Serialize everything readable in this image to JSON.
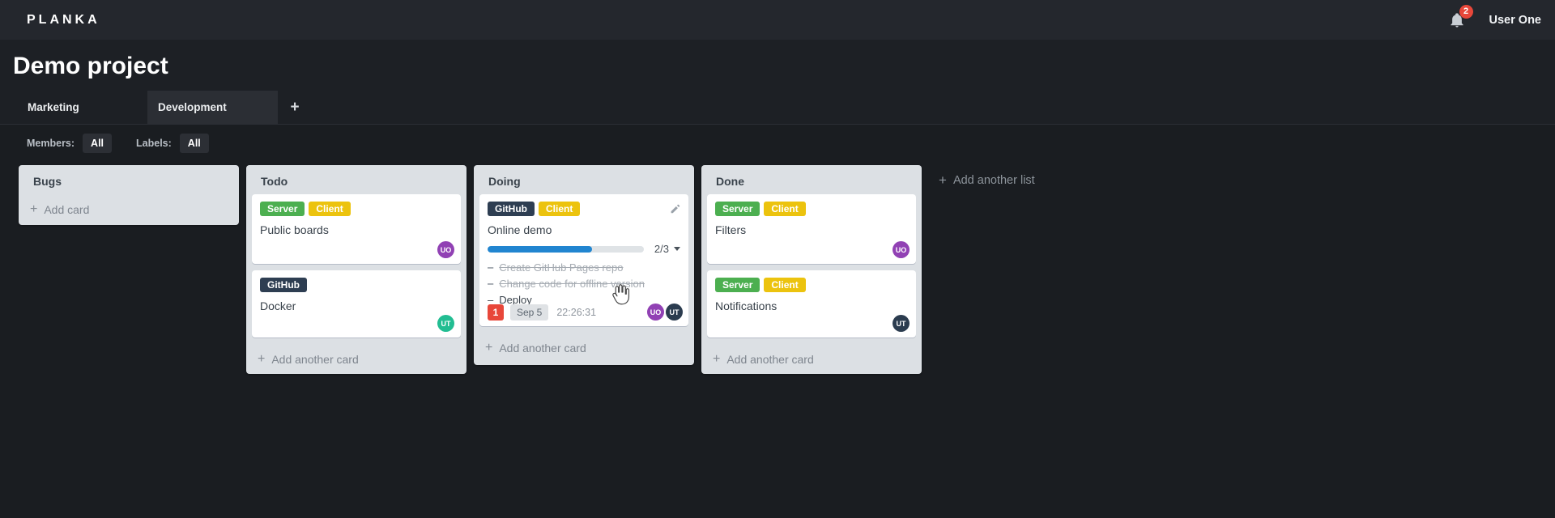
{
  "icons": {
    "plus": "+"
  },
  "colors": {
    "badge_red": "#e8473a",
    "progress_blue": "#2185d0",
    "label_green": "#4caf50",
    "label_yellow": "#ecc30e",
    "label_navy": "#2e3e52",
    "avatar_purple": "#9141b4",
    "avatar_teal": "#22bd92",
    "avatar_navy": "#2b3c4f"
  },
  "topbar": {
    "logo": "PLANKA",
    "notifications_count": "2",
    "user_name": "User One"
  },
  "project": {
    "title": "Demo project",
    "members": [
      {
        "initials": "UO",
        "color": "#9141b4"
      },
      {
        "initials": "UT",
        "color": "#22bd92"
      },
      {
        "initials": "UT",
        "color": "#2b3c4f"
      }
    ]
  },
  "tabs": [
    {
      "label": "Marketing",
      "active": false
    },
    {
      "label": "Development",
      "active": true
    }
  ],
  "filters": {
    "members_label": "Members:",
    "members_value": "All",
    "labels_label": "Labels:",
    "labels_value": "All"
  },
  "board": {
    "add_list_label": "Add another list",
    "lists": [
      {
        "title": "Bugs",
        "add_card_label": "Add card",
        "cards": []
      },
      {
        "title": "Todo",
        "add_card_label": "Add another card",
        "cards": [
          {
            "title": "Public boards",
            "labels": [
              {
                "name": "Server",
                "color": "#4caf50"
              },
              {
                "name": "Client",
                "color": "#ecc30e"
              }
            ],
            "member": {
              "initials": "UO",
              "color": "#9141b4"
            }
          },
          {
            "title": "Docker",
            "labels": [
              {
                "name": "GitHub",
                "color": "#2e3e52"
              }
            ],
            "member": {
              "initials": "UT",
              "color": "#22bd92"
            }
          }
        ]
      },
      {
        "title": "Doing",
        "add_card_label": "Add another card",
        "cards": [
          {
            "title": "Online demo",
            "labels": [
              {
                "name": "GitHub",
                "color": "#2e3e52"
              },
              {
                "name": "Client",
                "color": "#ecc30e"
              }
            ],
            "checklist": {
              "ratio_label": "2/3",
              "percent": 66.7,
              "items": [
                {
                  "bullet": "–",
                  "text": "Create GitHub Pages repo",
                  "completed": true
                },
                {
                  "bullet": "–",
                  "text": "Change code for offline version",
                  "completed": true
                },
                {
                  "bullet": "–",
                  "text": "Deploy",
                  "completed": false
                }
              ]
            },
            "notification_count": "1",
            "due_date": "Sep 5",
            "stopwatch": "22:26:31",
            "members": [
              {
                "initials": "UO",
                "color": "#9141b4"
              },
              {
                "initials": "UT",
                "color": "#2b3c4f"
              }
            ]
          }
        ]
      },
      {
        "title": "Done",
        "add_card_label": "Add another card",
        "cards": [
          {
            "title": "Filters",
            "labels": [
              {
                "name": "Server",
                "color": "#4caf50"
              },
              {
                "name": "Client",
                "color": "#ecc30e"
              }
            ],
            "member": {
              "initials": "UO",
              "color": "#9141b4"
            }
          },
          {
            "title": "Notifications",
            "labels": [
              {
                "name": "Server",
                "color": "#4caf50"
              },
              {
                "name": "Client",
                "color": "#ecc30e"
              }
            ],
            "member": {
              "initials": "UT",
              "color": "#2b3c4f"
            }
          }
        ]
      }
    ]
  }
}
